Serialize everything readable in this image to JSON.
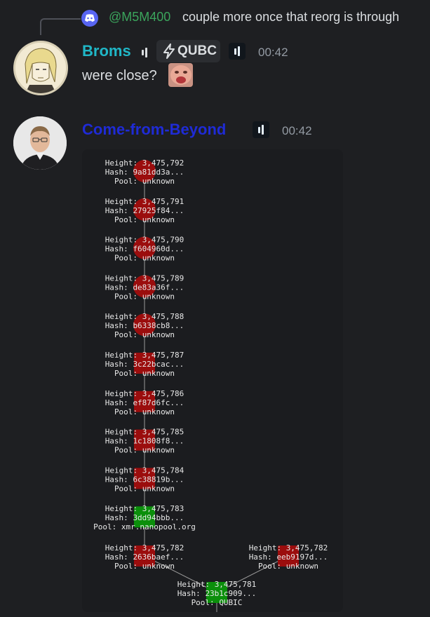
{
  "reply": {
    "mention": "@M5M400",
    "text": "couple more once that reorg is through"
  },
  "message1": {
    "username": "Broms",
    "tag": "QUBC",
    "time": "00:42",
    "text": "were close?"
  },
  "message2": {
    "username": "Come-from-Beyond",
    "time": "00:42"
  },
  "labels": {
    "height": "Height:",
    "hash": "Hash:",
    "pool": "Pool:"
  },
  "blocks": [
    {
      "height": "3,475,792",
      "hash": "9a81dd3a...",
      "pool": "unknown",
      "status": "orphan"
    },
    {
      "height": "3,475,791",
      "hash": "27925f84...",
      "pool": "unknown",
      "status": "orphan"
    },
    {
      "height": "3,475,790",
      "hash": "f604960d...",
      "pool": "unknown",
      "status": "orphan"
    },
    {
      "height": "3,475,789",
      "hash": "de83a36f...",
      "pool": "unknown",
      "status": "orphan"
    },
    {
      "height": "3,475,788",
      "hash": "b6338cb8...",
      "pool": "unknown",
      "status": "orphan"
    },
    {
      "height": "3,475,787",
      "hash": "3c22bcac...",
      "pool": "unknown",
      "status": "orphan"
    },
    {
      "height": "3,475,786",
      "hash": "ef87d6fc...",
      "pool": "unknown",
      "status": "orphan"
    },
    {
      "height": "3,475,785",
      "hash": "1c1808f8...",
      "pool": "unknown",
      "status": "orphan"
    },
    {
      "height": "3,475,784",
      "hash": "6c38819b...",
      "pool": "unknown",
      "status": "orphan"
    },
    {
      "height": "3,475,783",
      "hash": "3dd94bbb...",
      "pool": "xmr.nanopool.org",
      "status": "main"
    },
    {
      "height": "3,475,782",
      "hash": "2636baef...",
      "pool": "unknown",
      "status": "orphan"
    },
    {
      "height": "3,475,782",
      "hash": "eeb9197d...",
      "pool": "unknown",
      "status": "orphan"
    },
    {
      "height": "3,475,781",
      "hash": "23b1c909...",
      "pool": "QUBIC",
      "status": "main"
    }
  ],
  "colors": {
    "orphan": "#9b0d0d",
    "main": "#0b8f0b",
    "username1": "#20b7c7",
    "username2": "#1f2bd6",
    "mention": "#3ba55c",
    "discord": "#5865f2"
  },
  "icons": [
    "discord-icon",
    "lightning-icon",
    "bars-icon"
  ]
}
